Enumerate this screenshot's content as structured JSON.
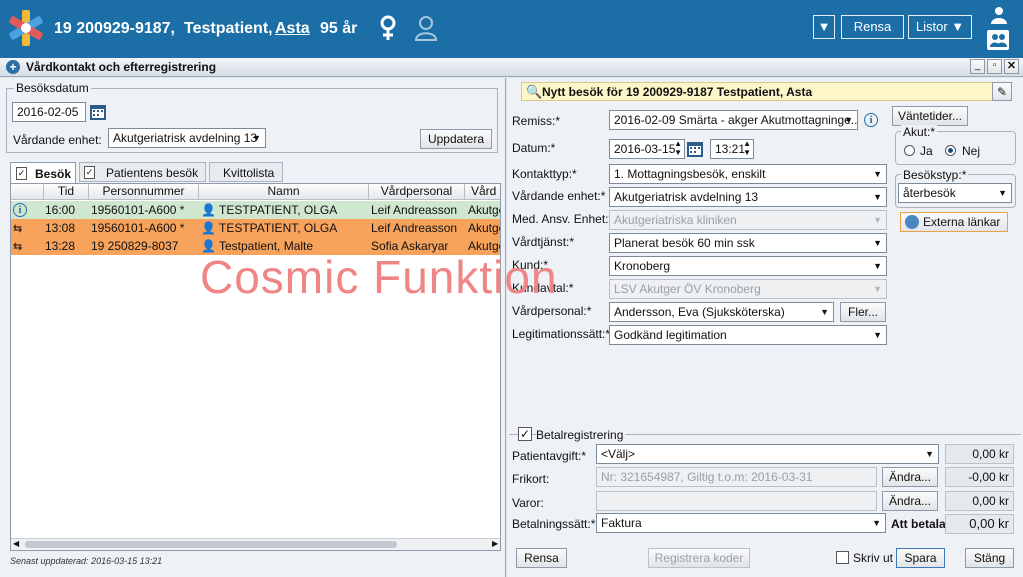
{
  "header": {
    "patient_id": "19 200929-9187,",
    "patient_name_prefix": "Testpatient,",
    "patient_first_name": "Asta",
    "patient_age": "95 år",
    "rensa_label": "Rensa",
    "listor_label": "Listor"
  },
  "window": {
    "title": "Vårdkontakt och efterregistrering"
  },
  "left": {
    "group_title": "Besöksdatum",
    "date_value": "2016-02-05",
    "unit_label": "Vårdande enhet:",
    "unit_value": "Akutgeriatrisk avdelning 13",
    "update_label": "Uppdatera",
    "tabs": [
      "Besök",
      "Patientens besök",
      "Kvittolista"
    ],
    "columns": [
      "Tid",
      "Personnummer",
      "Namn",
      "Vårdpersonal",
      "Vård"
    ],
    "rows": [
      {
        "tid": "16:00",
        "pnr": "19560101-A600 *",
        "namn": "TESTPATIENT, OLGA",
        "vp": "Leif Andreasson",
        "vard": "Akutge"
      },
      {
        "tid": "13:08",
        "pnr": "19560101-A600 *",
        "namn": "TESTPATIENT, OLGA",
        "vp": "Leif Andreasson",
        "vard": "Akutge"
      },
      {
        "tid": "13:28",
        "pnr": "19 250829-8037",
        "namn": "Testpatient, Malte",
        "vp": "Sofia Askaryar",
        "vard": "Akutge"
      }
    ],
    "last_updated": "Senast uppdaterad: 2016-03-15 13:21"
  },
  "watermark": "Cosmic Funktion",
  "right": {
    "heading": "Nytt besök för 19 200929-9187 Testpatient, Asta",
    "remiss_label": "Remiss:*",
    "remiss_value": "2016-02-09 Smärta - akger Akutmottagninge...",
    "vantetider_label": "Väntetider...",
    "datum_label": "Datum:*",
    "datum_value": "2016-03-15",
    "time_value": "13:21",
    "akut_label": "Akut:*",
    "akut_ja": "Ja",
    "akut_nej": "Nej",
    "kontakttyp_label": "Kontakttyp:*",
    "kontakttyp_value": "1.  Mottagningsbesök, enskilt",
    "vardande_label": "Vårdande enhet:*",
    "vardande_value": "Akutgeriatrisk avdelning 13",
    "besokstyp_label": "Besökstyp:*",
    "besokstyp_value": "återbesök",
    "med_label": "Med. Ansv. Enhet:*",
    "med_value": "Akutgeriatriska kliniken",
    "externa_label": "Externa länkar",
    "vardtjanst_label": "Vårdtjänst:*",
    "vardtjanst_value": "Planerat besök 60 min ssk",
    "kund_label": "Kund:*",
    "kund_value": "Kronoberg",
    "kundavtal_label": "Kundavtal:*",
    "kundavtal_value": "LSV Akutger ÖV Kronoberg",
    "vardpersonal_label": "Vårdpersonal:*",
    "vardpersonal_value": "Andersson, Eva (Sjuksköterska)",
    "fler_label": "Fler...",
    "legit_label": "Legitimationssätt:*",
    "legit_value": "Godkänd legitimation",
    "betal_title": "Betalregistrering",
    "patientavgift_label": "Patientavgift:*",
    "patientavgift_value": "<Välj>",
    "patientavgift_amount": "0,00 kr",
    "frikort_label": "Frikort:",
    "frikort_value": "Nr: 321654987, Giltig t.o.m: 2016-03-31",
    "andra_label": "Ändra...",
    "frikort_amount": "-0,00 kr",
    "varor_label": "Varor:",
    "varor_amount": "0,00 kr",
    "betalningssatt_label": "Betalningssätt:*",
    "betalningssatt_value": "Faktura",
    "att_betala_label": "Att betala:",
    "att_betala_amount": "0,00 kr",
    "rensa_label": "Rensa",
    "registrera_label": "Registrera koder",
    "skriv_ut_label": "Skriv ut",
    "spara_label": "Spara",
    "stang_label": "Stäng"
  },
  "colors": {
    "header_blue": "#1b6fa6",
    "selected_row": "#cfe6cf",
    "highlight_row": "#f7a35c"
  }
}
